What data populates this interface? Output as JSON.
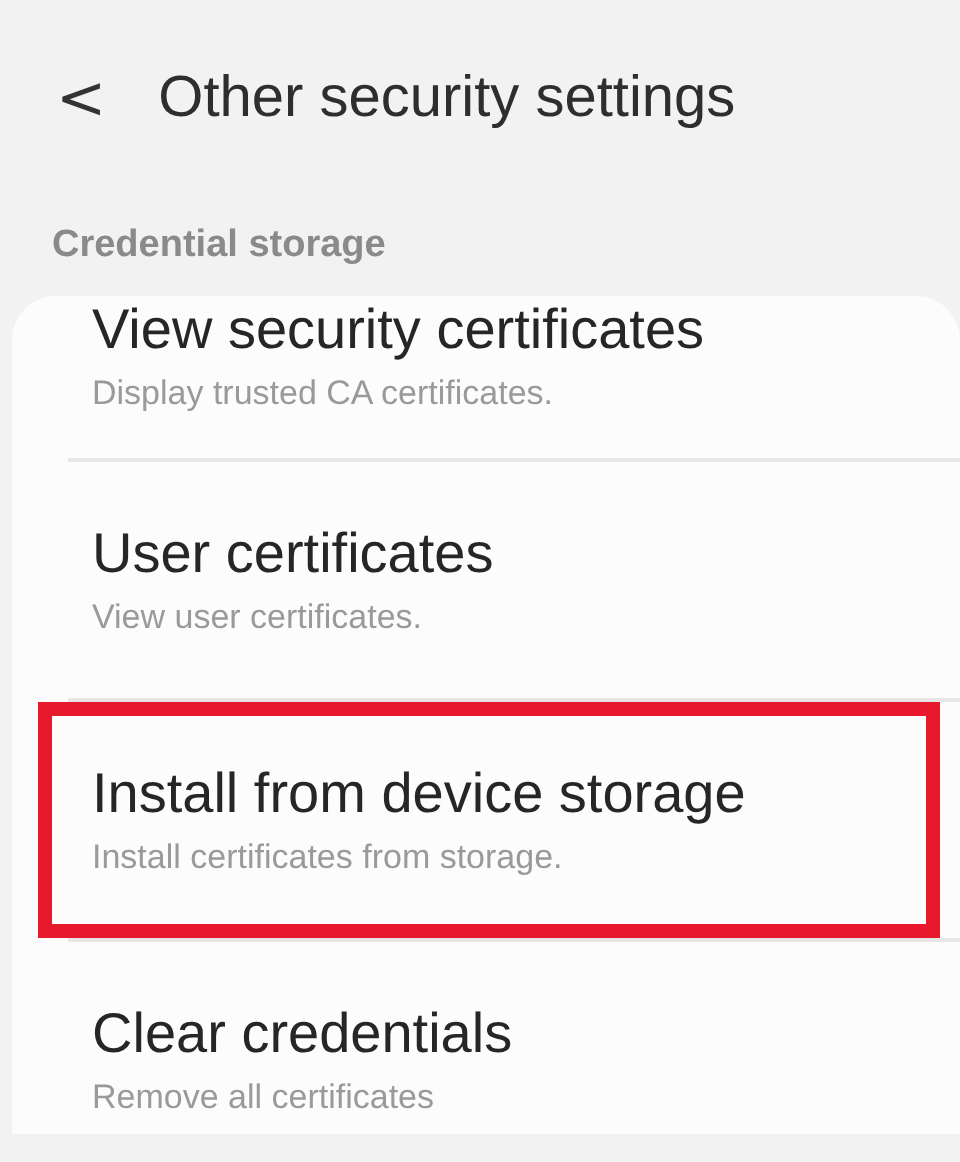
{
  "header": {
    "back": "<",
    "title": "Other security settings"
  },
  "section": {
    "label": "Credential storage"
  },
  "items": [
    {
      "title": "View security certificates",
      "subtitle": "Display trusted CA certificates.",
      "highlighted": false
    },
    {
      "title": "User certificates",
      "subtitle": "View user certificates.",
      "highlighted": false
    },
    {
      "title": "Install from device storage",
      "subtitle": "Install certificates from storage.",
      "highlighted": true
    },
    {
      "title": "Clear credentials",
      "subtitle": "Remove all certificates",
      "highlighted": false
    }
  ]
}
